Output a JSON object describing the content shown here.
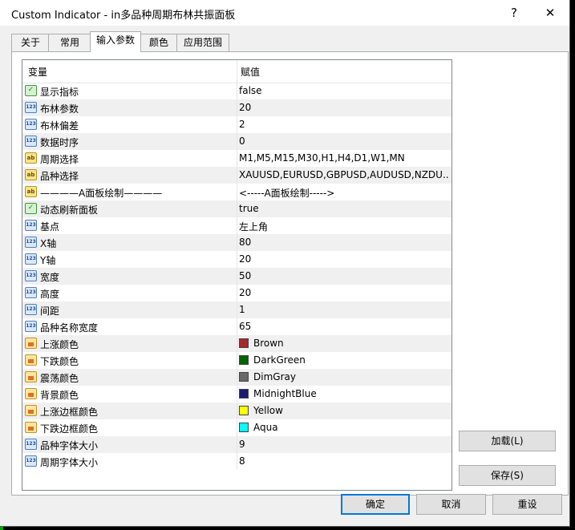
{
  "window": {
    "title": "Custom Indicator - in多品种周期布林共振面板",
    "help_label": "?",
    "close_label": "✕"
  },
  "tabs": [
    {
      "label": "关于"
    },
    {
      "label": "常用"
    },
    {
      "label": "输入参数",
      "active": true
    },
    {
      "label": "颜色"
    },
    {
      "label": "应用范围"
    }
  ],
  "grid": {
    "col_variable": "变量",
    "col_value": "赋值",
    "rows": [
      {
        "type": "bool",
        "icon": "bool-icon",
        "name": "显示指标",
        "value": "false"
      },
      {
        "type": "num",
        "icon": "int-icon",
        "name": "布林参数",
        "value": "20"
      },
      {
        "type": "num",
        "icon": "int-icon",
        "name": "布林偏差",
        "value": "2"
      },
      {
        "type": "num",
        "icon": "int-icon",
        "name": "数据时序",
        "value": "0"
      },
      {
        "type": "str",
        "icon": "string-icon",
        "name": "周期选择",
        "value": "M1,M5,M15,M30,H1,H4,D1,W1,MN"
      },
      {
        "type": "str",
        "icon": "string-icon",
        "name": "品种选择",
        "value": "XAUUSD,EURUSD,GBPUSD,AUDUSD,NZDU..."
      },
      {
        "type": "str",
        "icon": "string-icon",
        "name": "————A面板绘制————",
        "value": "<-----A面板绘制----->"
      },
      {
        "type": "bool",
        "icon": "bool-icon",
        "name": "动态刷新面板",
        "value": "true"
      },
      {
        "type": "num",
        "icon": "int-icon",
        "name": "基点",
        "value": "左上角"
      },
      {
        "type": "num",
        "icon": "int-icon",
        "name": "X轴",
        "value": "80"
      },
      {
        "type": "num",
        "icon": "int-icon",
        "name": "Y轴",
        "value": "20"
      },
      {
        "type": "num",
        "icon": "int-icon",
        "name": "宽度",
        "value": "50"
      },
      {
        "type": "num",
        "icon": "int-icon",
        "name": "高度",
        "value": "20"
      },
      {
        "type": "num",
        "icon": "int-icon",
        "name": "间距",
        "value": "1"
      },
      {
        "type": "num",
        "icon": "int-icon",
        "name": "品种名称宽度",
        "value": "65"
      },
      {
        "type": "color",
        "icon": "color-icon",
        "name": "上涨颜色",
        "value": "Brown",
        "swatch": "#a52a2a"
      },
      {
        "type": "color",
        "icon": "color-icon",
        "name": "下跌颜色",
        "value": "DarkGreen",
        "swatch": "#006400"
      },
      {
        "type": "color",
        "icon": "color-icon",
        "name": "震荡颜色",
        "value": "DimGray",
        "swatch": "#696969"
      },
      {
        "type": "color",
        "icon": "color-icon",
        "name": "背景颜色",
        "value": "MidnightBlue",
        "swatch": "#191970"
      },
      {
        "type": "color",
        "icon": "color-icon",
        "name": "上涨边框颜色",
        "value": "Yellow",
        "swatch": "#ffff00"
      },
      {
        "type": "color",
        "icon": "color-icon",
        "name": "下跌边框颜色",
        "value": "Aqua",
        "swatch": "#00ffff"
      },
      {
        "type": "num",
        "icon": "int-icon",
        "name": "品种字体大小",
        "value": "9"
      },
      {
        "type": "num",
        "icon": "int-icon",
        "name": "周期字体大小",
        "value": "8"
      }
    ]
  },
  "buttons": {
    "load": "加载(L)",
    "save": "保存(S)",
    "ok": "确定",
    "cancel": "取消",
    "reset": "重设"
  }
}
